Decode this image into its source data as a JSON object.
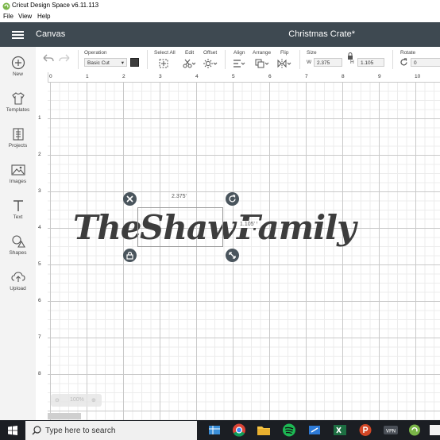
{
  "window": {
    "title": "Cricut Design Space  v6.11.113"
  },
  "menu": [
    "File",
    "View",
    "Help"
  ],
  "header": {
    "canvas_label": "Canvas",
    "doc_title": "Christmas Crate*"
  },
  "sidebar": [
    {
      "label": "New",
      "icon": "plus-circle-icon"
    },
    {
      "label": "Templates",
      "icon": "shirt-icon"
    },
    {
      "label": "Projects",
      "icon": "projects-icon"
    },
    {
      "label": "Images",
      "icon": "images-icon"
    },
    {
      "label": "Text",
      "icon": "text-icon"
    },
    {
      "label": "Shapes",
      "icon": "shapes-icon"
    },
    {
      "label": "Upload",
      "icon": "upload-icon"
    }
  ],
  "toolbar": {
    "operation_label": "Operation",
    "operation_value": "Basic Cut",
    "operation_color": "#3d3d3d",
    "select_all_label": "Select All",
    "edit_label": "Edit",
    "offset_label": "Offset",
    "align_label": "Align",
    "arrange_label": "Arrange",
    "flip_label": "Flip",
    "size_label": "Size",
    "w_label": "W",
    "w_value": "2.375",
    "h_label": "H",
    "h_value": "1.105",
    "rotate_label": "Rotate",
    "rotate_value": "0"
  },
  "ruler_top": [
    "0",
    "1",
    "2",
    "3",
    "4",
    "5",
    "6",
    "7",
    "8",
    "9",
    "10",
    "11"
  ],
  "ruler_left": [
    "1",
    "2",
    "3",
    "4",
    "5",
    "6",
    "7",
    "8"
  ],
  "canvas": {
    "text_left": "The",
    "text_selected": "Shaw",
    "text_right": "Family",
    "width_dim": "2.375'",
    "height_dim": "1.105'"
  },
  "zoom": {
    "value": "100%"
  },
  "taskbar": {
    "search_placeholder": "Type here to search"
  },
  "colors": {
    "header_bg": "#3e4951",
    "sidebar_bg": "#f3f3f3",
    "text_color": "#3d3d3d",
    "taskbar_bg": "#1b1e23"
  }
}
